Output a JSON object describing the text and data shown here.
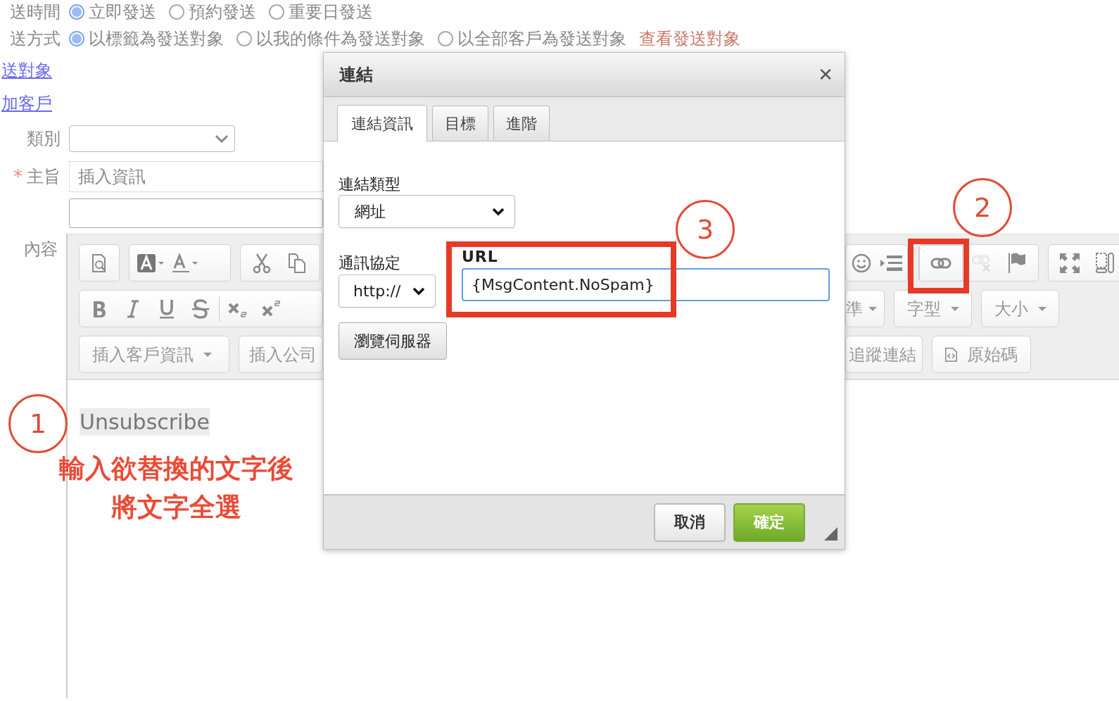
{
  "form": {
    "rows": [
      {
        "label": "送時間",
        "options": [
          {
            "label": "立即發送",
            "selected": true
          },
          {
            "label": "預約發送",
            "selected": false
          },
          {
            "label": "重要日發送",
            "selected": false
          }
        ]
      },
      {
        "label": "送方式",
        "options": [
          {
            "label": "以標籤為發送對象",
            "selected": true
          },
          {
            "label": "以我的條件為發送對象",
            "selected": false
          },
          {
            "label": "以全部客戶為發送對象",
            "selected": false
          }
        ],
        "link": "查看發送對象"
      }
    ],
    "links": [
      "送對象",
      "加客戶"
    ],
    "category": {
      "label": "類別"
    },
    "subject": {
      "label": "主旨",
      "required": true,
      "required_mark": "*",
      "insert_menu": "插入資訊"
    },
    "content_label": "內容"
  },
  "editor": {
    "toolbar": {
      "link_button": {
        "focused": true
      },
      "unlink_button": {
        "disabled": true
      },
      "format_menu": "準",
      "font_menu": "字型",
      "size_menu": "大小",
      "customer_menu": "插入客戶資訊",
      "company_menu": "插入公司",
      "tracking_button": "追蹤連結",
      "source_button": "原始碼"
    },
    "text": {
      "value": "Unsubscribe",
      "selected": true
    }
  },
  "dialog": {
    "title": "連結",
    "close": "✕",
    "tabs": [
      {
        "label": "連結資訊",
        "selected": true
      },
      {
        "label": "目標",
        "selected": false
      },
      {
        "label": "進階",
        "selected": false
      }
    ],
    "link_type": {
      "label": "連結類型",
      "value": "網址"
    },
    "protocol": {
      "label": "通訊協定",
      "value": "http://"
    },
    "url": {
      "label": "URL",
      "value": "{MsgContent.NoSpam}"
    },
    "browse_button": "瀏覽伺服器",
    "buttons": [
      {
        "label": "取消",
        "kind": "cancel"
      },
      {
        "label": "確定",
        "kind": "ok"
      }
    ]
  },
  "annotations": {
    "steps": [
      "1",
      "2",
      "3"
    ],
    "note": [
      "輸入欲替換的文字後",
      "將文字全選"
    ]
  }
}
